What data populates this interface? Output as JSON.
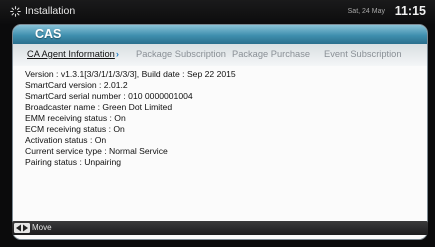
{
  "header": {
    "title": "Installation",
    "date": "Sat, 24 May",
    "time": "11:15"
  },
  "panel": {
    "title": "CAS",
    "tabs": [
      {
        "label": "CA Agent Information",
        "active": true
      },
      {
        "label": "Package Subscription",
        "active": false
      },
      {
        "label": "Package Purchase",
        "active": false
      },
      {
        "label": "Event Subscription",
        "active": false
      }
    ],
    "info_lines": [
      "Version : v1.3.1[3/3/1/1/3/3/3], Build date : Sep 22 2015",
      "SmartCard version : 2.01.2",
      "SmartCard serial number : 010 0000001004",
      "Broadcaster name : Green Dot Limited",
      "EMM receiving status : On",
      "ECM receiving status : On",
      "Activation status : On",
      "Current service type : Normal Service",
      "Pairing status : Unpairing"
    ]
  },
  "footer": {
    "move_label": "Move",
    "move_icon": "left-right-arrows-icon"
  },
  "colors": {
    "header_accent": "#3f8fae",
    "active_tab_chevron": "#2a82c4",
    "inactive_tab_text": "#8a9096"
  }
}
